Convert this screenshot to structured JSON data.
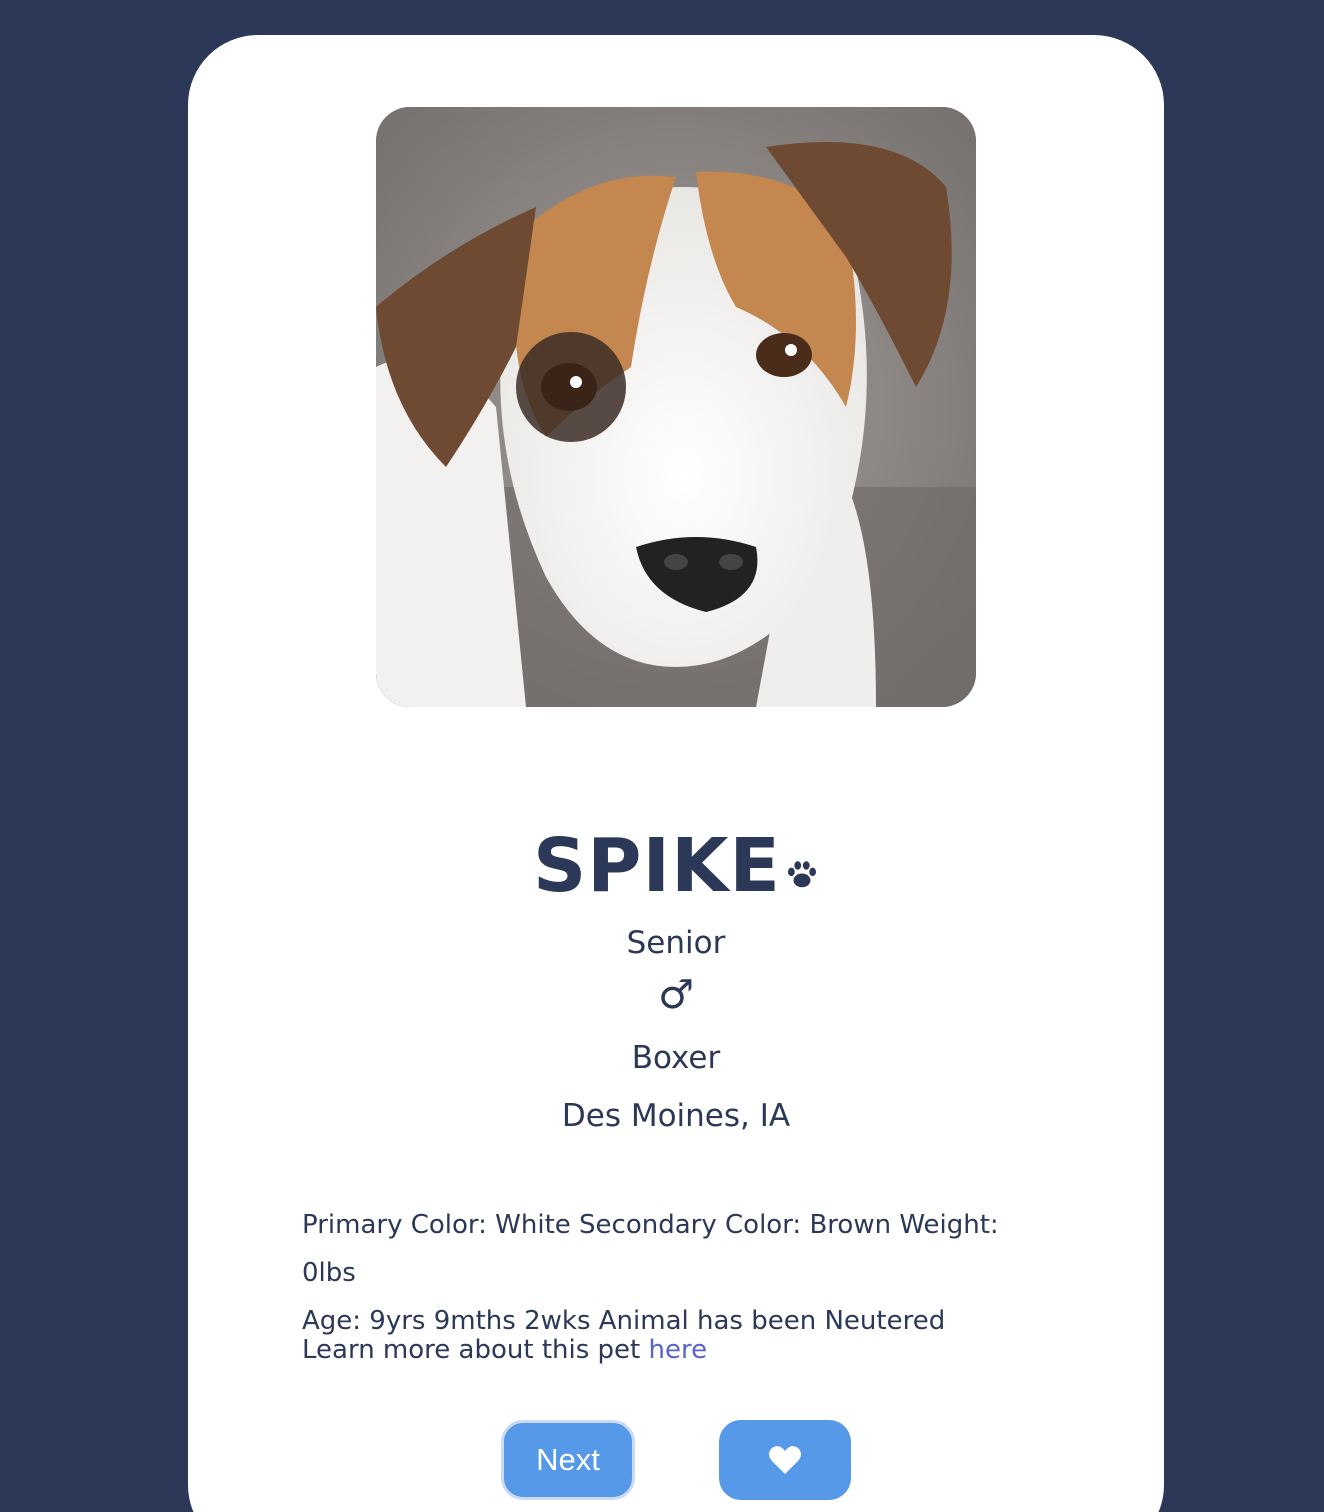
{
  "pet": {
    "photo_alt": "SPIKE",
    "name": "SPIKE",
    "name_icon": "paw-icon",
    "age_group": "Senior",
    "gender_symbol": "♂",
    "breed": "Boxer",
    "location": "Des Moines, IA",
    "details_line1": "Primary Color: White Secondary Color: Brown Weight: 0lbs",
    "details_line2": "Age: 9yrs 9mths 2wks Animal has been Neutered",
    "learn_more_text": "Learn more about this pet ",
    "learn_more_link": "here"
  },
  "actions": {
    "next_label": "Next",
    "favorite_icon": "heart-icon"
  },
  "colors": {
    "background": "#2c3857",
    "card": "#ffffff",
    "text": "#2c3857",
    "button": "#5699e8",
    "link": "#5964c9"
  }
}
